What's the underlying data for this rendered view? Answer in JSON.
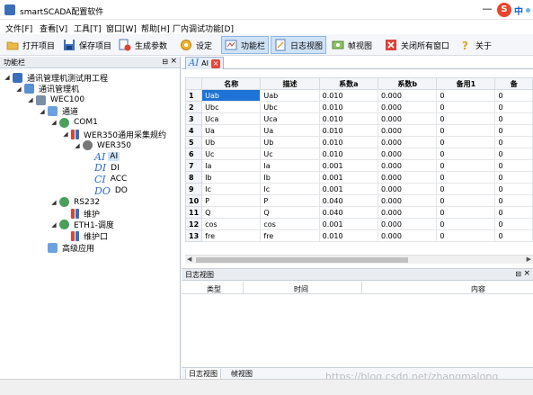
{
  "window": {
    "title": "smartSCADA配置软件"
  },
  "ime": {
    "logo": "S",
    "lang": "中"
  },
  "menu": [
    "文件[F]",
    "查看[V]",
    "工具[T]",
    "窗口[W]",
    "帮助[H]",
    "厂内调试功能[D]"
  ],
  "toolbar": {
    "open": "打开项目",
    "save": "保存项目",
    "generate": "生成参数",
    "settings": "设定",
    "function_bar": "功能栏",
    "log_view": "日志视图",
    "frame_view": "帧视图",
    "close_all": "关闭所有窗口",
    "about": "关于"
  },
  "left_panel": {
    "title": "功能栏",
    "pin": "ꟹ ×",
    "tree": [
      {
        "label": "通讯管理机测试用工程",
        "indent": 0,
        "caret": "◢",
        "icon": "home-icon"
      },
      {
        "label": "通讯管理机",
        "indent": 1,
        "caret": "◢",
        "icon": "computer-icon"
      },
      {
        "label": "WEC100",
        "indent": 2,
        "caret": "◢",
        "icon": "plug-icon"
      },
      {
        "label": "通道",
        "indent": 3,
        "caret": "◢",
        "icon": "folder-icon"
      },
      {
        "label": "COM1",
        "indent": 4,
        "caret": "◢",
        "icon": "port-icon"
      },
      {
        "label": "WER350通用采集规约",
        "indent": 5,
        "caret": "◢",
        "icon": "protocol-icon"
      },
      {
        "label": "WER350",
        "indent": 6,
        "caret": "◢",
        "icon": "gear-icon"
      },
      {
        "label": "AI",
        "indent": 7,
        "caret": "",
        "icon": "AI",
        "selected": true
      },
      {
        "label": "DI",
        "indent": 7,
        "caret": "",
        "icon": "DI"
      },
      {
        "label": "ACC",
        "indent": 7,
        "caret": "",
        "icon": "CI"
      },
      {
        "label": "DO",
        "indent": 7,
        "caret": "",
        "icon": "DO"
      },
      {
        "label": "RS232",
        "indent": 4,
        "caret": "◢",
        "icon": "port-icon"
      },
      {
        "label": "维护",
        "indent": 5,
        "caret": "",
        "icon": "protocol-icon"
      },
      {
        "label": "ETH1-调度",
        "indent": 4,
        "caret": "◢",
        "icon": "port-icon"
      },
      {
        "label": "维护口",
        "indent": 5,
        "caret": "",
        "icon": "protocol-icon"
      },
      {
        "label": "高级应用",
        "indent": 3,
        "caret": "",
        "icon": "folder-icon"
      }
    ]
  },
  "doc_tab": {
    "icon_text": "AI",
    "label": "AI",
    "close": "×"
  },
  "table": {
    "columns": [
      "",
      "名称",
      "描述",
      "系数a",
      "系数b",
      "备用1",
      "备"
    ],
    "rows": [
      [
        "1",
        "Uab",
        "Uab",
        "0.010",
        "0.000",
        "0",
        "0"
      ],
      [
        "2",
        "Ubc",
        "Ubc",
        "0.010",
        "0.000",
        "0",
        "0"
      ],
      [
        "3",
        "Uca",
        "Uca",
        "0.010",
        "0.000",
        "0",
        "0"
      ],
      [
        "4",
        "Ua",
        "Ua",
        "0.010",
        "0.000",
        "0",
        "0"
      ],
      [
        "5",
        "Ub",
        "Ub",
        "0.010",
        "0.000",
        "0",
        "0"
      ],
      [
        "6",
        "Uc",
        "Uc",
        "0.010",
        "0.000",
        "0",
        "0"
      ],
      [
        "7",
        "Ia",
        "Ia",
        "0.001",
        "0.000",
        "0",
        "0"
      ],
      [
        "8",
        "Ib",
        "Ib",
        "0.001",
        "0.000",
        "0",
        "0"
      ],
      [
        "9",
        "Ic",
        "Ic",
        "0.001",
        "0.000",
        "0",
        "0"
      ],
      [
        "10",
        "P",
        "P",
        "0.040",
        "0.000",
        "0",
        "0"
      ],
      [
        "11",
        "Q",
        "Q",
        "0.040",
        "0.000",
        "0",
        "0"
      ],
      [
        "12",
        "cos",
        "cos",
        "0.001",
        "0.000",
        "0",
        "0"
      ],
      [
        "13",
        "fre",
        "fre",
        "0.010",
        "0.000",
        "0",
        "0"
      ]
    ]
  },
  "log_panel": {
    "title": "日志视图",
    "pin": "ꟹ ×",
    "columns": [
      "类型",
      "时间",
      "内容"
    ]
  },
  "bottom_tabs": [
    "日志视图",
    "帧视图"
  ],
  "watermark": "https://blog.csdn.net/zhangmalong"
}
